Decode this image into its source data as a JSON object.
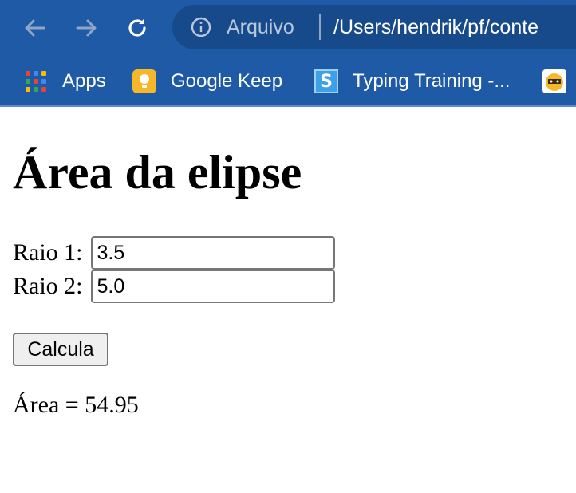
{
  "browser": {
    "address_scheme": "Arquivo",
    "address_url": "/Users/hendrik/pf/conte",
    "bookmarks": [
      {
        "label": "Apps",
        "icon": "apps-grid-icon"
      },
      {
        "label": "Google Keep",
        "icon": "google-keep-icon"
      },
      {
        "label": "Typing Training -...",
        "icon": "typing-training-icon"
      },
      {
        "label": "",
        "icon": "bookmark-favicon"
      }
    ],
    "colors": {
      "toolbar": "#1f5aa6",
      "omnibox": "#174a8b"
    }
  },
  "page": {
    "title": "Área da elipse",
    "raio1_label": "Raio 1:",
    "raio1_value": "3.5",
    "raio2_label": "Raio 2:",
    "raio2_value": "5.0",
    "button_label": "Calcula",
    "result": "Área = 54.95"
  }
}
